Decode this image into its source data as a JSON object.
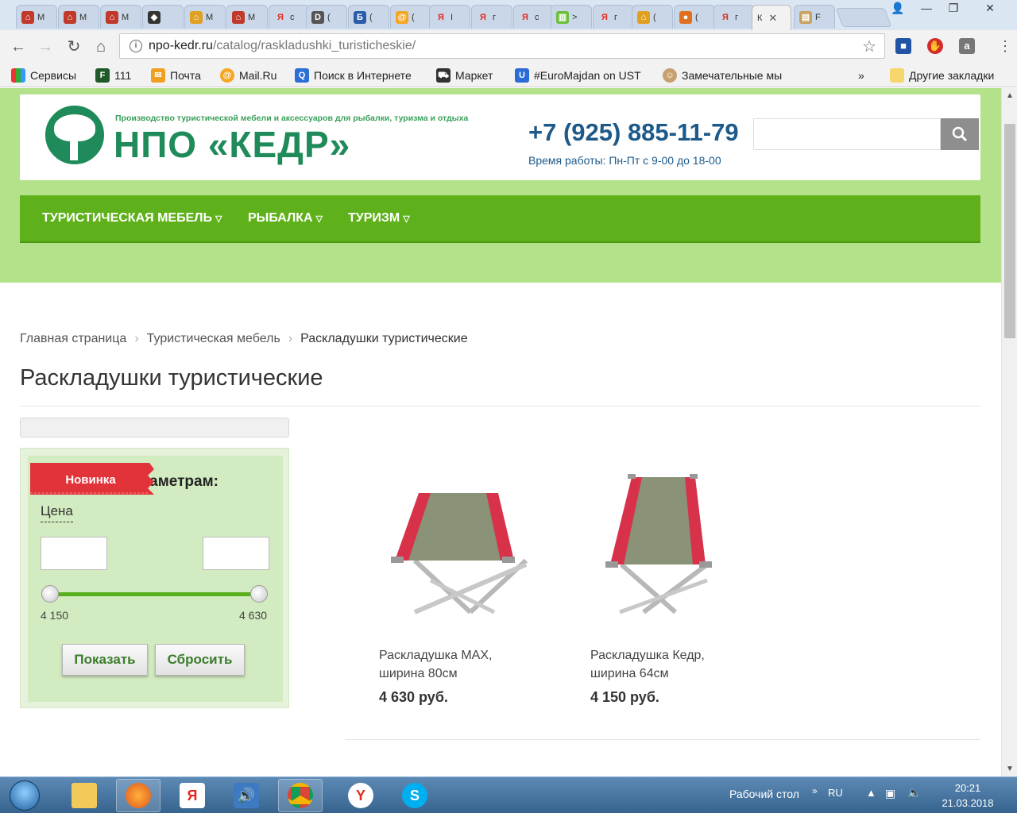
{
  "browser": {
    "active_tab_label": "К",
    "tabs": [
      {
        "label": "М",
        "icon": "kedr-favicon"
      },
      {
        "label": "М",
        "icon": "kedr-favicon"
      },
      {
        "label": "М",
        "icon": "kedr-favicon"
      },
      {
        "label": "",
        "icon": "shield-favicon"
      },
      {
        "label": "М",
        "icon": "kedr-favicon"
      },
      {
        "label": "М",
        "icon": "kedr-favicon"
      },
      {
        "label": "с",
        "icon": "yandex-favicon"
      },
      {
        "label": "(",
        "icon": "dx-favicon"
      },
      {
        "label": "(",
        "icon": "b-favicon"
      },
      {
        "label": "(",
        "icon": "mail-favicon"
      },
      {
        "label": "I",
        "icon": "yandex-favicon"
      },
      {
        "label": "г",
        "icon": "yandex-favicon"
      },
      {
        "label": "с",
        "icon": "yandex-favicon"
      },
      {
        "label": ">",
        "icon": "chart-favicon"
      },
      {
        "label": "г",
        "icon": "yandex-favicon"
      },
      {
        "label": "(",
        "icon": "kedr-favicon"
      },
      {
        "label": "(",
        "icon": "food-favicon"
      },
      {
        "label": "г",
        "icon": "yandex-favicon"
      }
    ],
    "extra_tab_label": "F",
    "url_host": "npo-kedr.ru",
    "url_path": "/catalog/raskladushki_turisticheskie/",
    "window_controls": {
      "minimize": "—",
      "maximize": "❐",
      "close": "✕"
    }
  },
  "bookmarks": [
    {
      "label": "Сервисы",
      "icon": "apps-grid-icon"
    },
    {
      "label": "111",
      "icon": "f-icon"
    },
    {
      "label": "Почта",
      "icon": "mail-envelope-icon"
    },
    {
      "label": "Mail.Ru",
      "icon": "mailru-icon"
    },
    {
      "label": "Поиск в Интернете",
      "icon": "search-q-icon"
    },
    {
      "label": "Маркет",
      "icon": "cart-icon"
    },
    {
      "label": "#EuroMajdan on UST",
      "icon": "u-icon"
    },
    {
      "label": "Замечательные мы",
      "icon": "person-icon"
    }
  ],
  "bookmarks_more": "»",
  "other_bookmarks": "Другие закладки",
  "site": {
    "tagline": "Производство туристической мебели и аксессуаров для рыбалки, туризма и отдыха",
    "brand": "НПО «КЕДР»",
    "phone": "+7 (925) 885-11-79",
    "hours": "Время работы: Пн-Пт с 9-00 до 18-00",
    "search_placeholder": ""
  },
  "nav": [
    {
      "label": "ТУРИСТИЧЕСКАЯ МЕБЕЛЬ"
    },
    {
      "label": "РЫБАЛКА"
    },
    {
      "label": "ТУРИЗМ"
    }
  ],
  "breadcrumb": {
    "home": "Главная страница",
    "section": "Туристическая мебель",
    "current": "Раскладушки туристические",
    "separator": "›"
  },
  "page_title": "Раскладушки туристические",
  "filter": {
    "heading": "Выбор по параметрам:",
    "price_label": "Цена",
    "min_input": "",
    "max_input": "",
    "min_value": "4 150",
    "max_value": "4 630",
    "show_button": "Показать",
    "reset_button": "Сбросить"
  },
  "products": [
    {
      "name": "Раскладушка MAX, ширина 80см",
      "price": "4 630 руб.",
      "badge": "Новинка"
    },
    {
      "name": "Раскладушка Кедр, ширина 64см",
      "price": "4 150 руб.",
      "badge": ""
    }
  ],
  "taskbar": {
    "desktop_label": "Рабочий стол",
    "language": "RU",
    "time": "20:21",
    "date": "21.03.2018",
    "apps": [
      "explorer-icon",
      "firefox-icon",
      "yandex-browser-icon",
      "sound-icon",
      "chrome-icon",
      "yandex-icon",
      "skype-icon"
    ]
  },
  "colors": {
    "nav_green": "#5fb11b",
    "band_green": "#b4e28a",
    "brand_green": "#1f8a5a",
    "phone_blue": "#1d5a8a",
    "badge_red": "#e2323a"
  }
}
